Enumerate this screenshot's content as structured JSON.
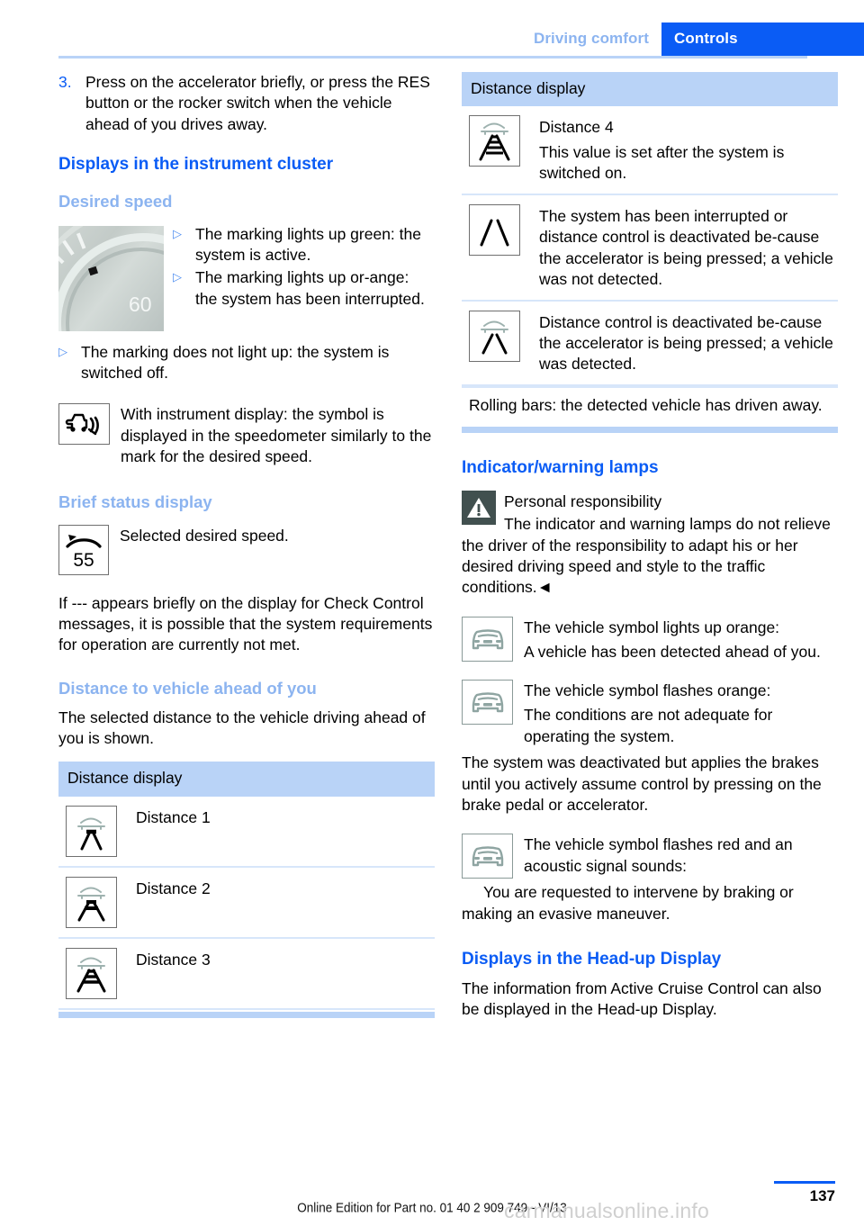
{
  "header": {
    "chapter": "Driving comfort",
    "section": "Controls"
  },
  "left": {
    "step": {
      "number": "3.",
      "text": "Press on the accelerator briefly, or press the RES button or the rocker switch when the vehicle ahead of you drives away."
    },
    "heading_cluster": "Displays in the instrument cluster",
    "sub_desired_speed": "Desired speed",
    "speedo_number": "60",
    "bullets_figure": [
      "The marking lights up green: the system is active.",
      "The marking lights up or-ange: the system has been interrupted."
    ],
    "bullet_off": "The marking does not light up: the system is switched off.",
    "instrument_display_text": "With instrument display: the symbol is displayed in the speedometer similarly to the mark for the desired speed.",
    "sub_brief_status": "Brief status display",
    "brief_status_icon_value": "55",
    "brief_status_text": "Selected desired speed.",
    "check_control_text": "If --- appears briefly on the display for Check Control messages, it is possible that the system requirements for operation are currently not met.",
    "sub_distance": "Distance to vehicle ahead of you",
    "distance_intro": "The selected distance to the vehicle driving ahead of you is shown.",
    "table_header": "Distance display",
    "table_rows": [
      {
        "icon": "distance-1-icon",
        "label": "Distance 1",
        "bars": 1
      },
      {
        "icon": "distance-2-icon",
        "label": "Distance 2",
        "bars": 2
      },
      {
        "icon": "distance-3-icon",
        "label": "Distance 3",
        "bars": 3
      }
    ]
  },
  "right": {
    "table_header": "Distance display",
    "table_rows": [
      {
        "icon": "distance-4-icon",
        "label": "Distance 4",
        "text": "This value is set after the system is switched on.",
        "bars": 4,
        "car": true
      },
      {
        "icon": "lane-only-icon",
        "label": "",
        "text": "The system has been interrupted or distance control is deactivated be-cause the accelerator is being pressed; a vehicle was not detected.",
        "bars": 0,
        "car": false
      },
      {
        "icon": "car-lane-icon",
        "label": "",
        "text": "Distance control is deactivated be-cause the accelerator is being pressed; a vehicle was detected.",
        "bars": 0,
        "car": true
      }
    ],
    "table_note": "Rolling bars: the detected vehicle has driven away.",
    "heading_lamps": "Indicator/warning lamps",
    "warning_title": "Personal responsibility",
    "warning_body": "The indicator and warning lamps do not relieve the driver of the responsibility to adapt his or her desired driving speed and style to the traffic conditions.◄",
    "lamp_rows": [
      {
        "icon": "vehicle-symbol-icon",
        "line1": "The vehicle symbol lights up orange:",
        "line2": "A vehicle has been detected ahead of you."
      },
      {
        "icon": "vehicle-symbol-icon",
        "line1": "The vehicle symbol flashes orange:",
        "line2": "The conditions are not adequate for operating the system."
      }
    ],
    "deactivated_text": "The system was deactivated but applies the brakes until you actively assume control by pressing on the brake pedal or accelerator.",
    "red_lamp": {
      "icon": "vehicle-symbol-icon",
      "line1": "The vehicle symbol flashes red and an acoustic signal sounds:",
      "line2": "You are requested to intervene by braking or making an evasive maneuver."
    },
    "heading_hud": "Displays in the Head-up Display",
    "hud_text": "The information from Active Cruise Control can also be displayed in the Head-up Display."
  },
  "footer": {
    "online_edition": "Online Edition for Part no. 01 40 2 909 749 - VI/13",
    "page_number": "137",
    "watermark": "carmanualsonline.info"
  },
  "colors": {
    "accent_blue": "#0a5cf5",
    "light_blue": "#8cb4f0",
    "rule_blue": "#b9d3f7",
    "warn_dark": "#41504f"
  }
}
